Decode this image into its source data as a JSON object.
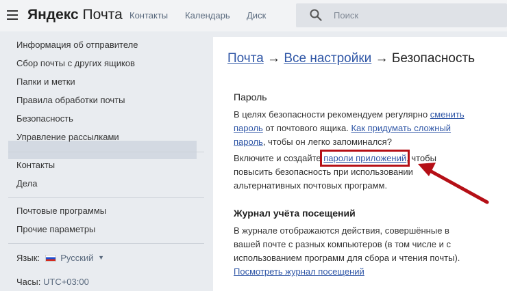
{
  "header": {
    "logo_brand": "Яндекс",
    "logo_product": "Почта",
    "nav": [
      "Контакты",
      "Календарь",
      "Диск"
    ],
    "search_placeholder": "Поиск"
  },
  "sidebar": {
    "group1": [
      "Информация об отправителе",
      "Сбор почты с других ящиков",
      "Папки и метки",
      "Правила обработки почты",
      "Безопасность",
      "Управление рассылками"
    ],
    "active_index": 4,
    "group2": [
      "Контакты",
      "Дела"
    ],
    "group3": [
      "Почтовые программы",
      "Прочие параметры"
    ],
    "language_label": "Язык:",
    "language_value": "Русский",
    "time_label": "Часы:",
    "time_value": "UTC+03:00"
  },
  "main": {
    "breadcrumb": {
      "mail": "Почта",
      "sep": "→",
      "all_settings": "Все настройки",
      "current": "Безопасность"
    },
    "password": {
      "title": "Пароль",
      "p1_text1": "В целях безопасности рекомендуем регулярно ",
      "p1_link1": "сменить пароль",
      "p1_text2": " от почтового ящика. ",
      "p1_link2": "Как придумать сложный пароль",
      "p1_text3": ", чтобы он легко запоминался?",
      "p2_text1": "Включите и создайте ",
      "p2_link": "пароли приложений",
      "p2_text2": ", чтобы повысить безопасность при использовании альтернативных почтовых программ."
    },
    "journal": {
      "title": "Журнал учёта посещений",
      "text": "В журнале отображаются действия, совершённые в вашей почте с разных компьютеров (в том числе и с использованием программ для сбора и чтения почты). ",
      "link": "Посмотреть журнал посещений"
    }
  },
  "colors": {
    "link": "#2f56a6",
    "highlight": "#b50f16",
    "active_item": "#d3d9e2"
  }
}
